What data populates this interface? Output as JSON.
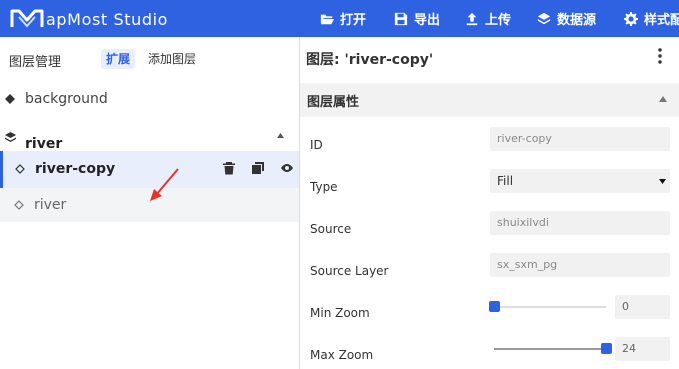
{
  "app": {
    "name": "apMost Studio",
    "logo_letter": "M"
  },
  "toolbar": [
    {
      "label": "打开",
      "icon": "folder-open-icon"
    },
    {
      "label": "导出",
      "icon": "save-icon"
    },
    {
      "label": "上传",
      "icon": "upload-icon"
    },
    {
      "label": "数据源",
      "icon": "layers-stack-icon"
    },
    {
      "label": "样式配",
      "icon": "gear-icon"
    }
  ],
  "layers_panel": {
    "title": "图层管理",
    "tabs": [
      {
        "label": "扩展",
        "active": true
      },
      {
        "label": "添加图层",
        "active": false
      }
    ],
    "items": [
      {
        "label": "background",
        "icon": "fill-diamond-icon"
      },
      {
        "label": "river",
        "icon": "layer-group-icon",
        "group": true
      },
      {
        "label": "river-copy",
        "icon": "diamond-outline-icon",
        "selected": true
      },
      {
        "label": "river",
        "icon": "diamond-outline-icon"
      }
    ]
  },
  "properties_panel": {
    "title": "图层: 'river-copy'",
    "section_title": "图层属性",
    "fields": [
      {
        "label": "ID",
        "value": "river-copy"
      },
      {
        "label": "Type",
        "value": "Fill"
      },
      {
        "label": "Source",
        "value": "shuixilvdi"
      },
      {
        "label": "Source Layer",
        "value": "sx_sxm_pg"
      },
      {
        "label": "Min Zoom",
        "value": "0",
        "level": 0
      },
      {
        "label": "Max Zoom",
        "value": "24",
        "level": 1
      }
    ]
  },
  "colors": {
    "accent": "#2f62e0",
    "selected_bg": "#e8eefc",
    "annotation": "#e8312b"
  }
}
